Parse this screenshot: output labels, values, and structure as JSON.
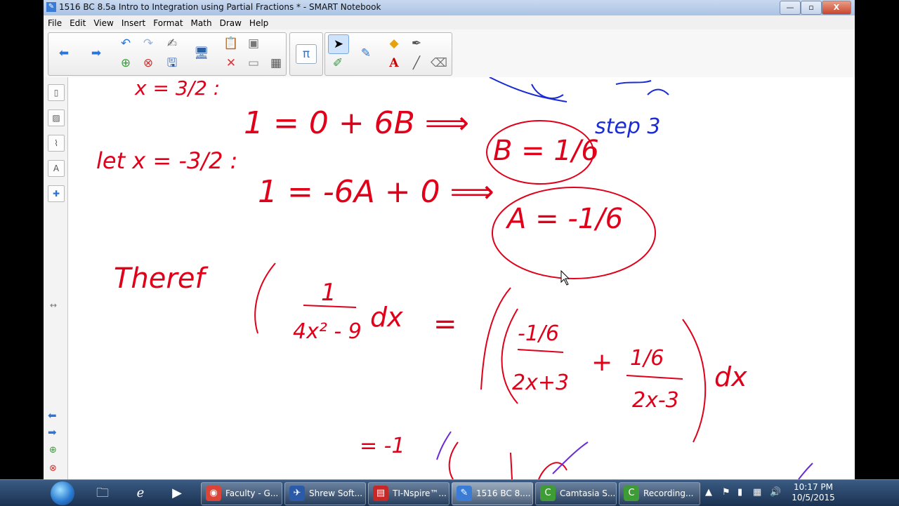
{
  "window": {
    "title": "1516 BC 8.5a Intro to Integration using Partial Fractions * - SMART Notebook",
    "minimize": "—",
    "maximize": "▫",
    "close": "X"
  },
  "menu": [
    "File",
    "Edit",
    "View",
    "Insert",
    "Format",
    "Math",
    "Draw",
    "Help"
  ],
  "toolbar": {
    "back_icon": "arrow-left-icon",
    "forward_icon": "arrow-right-icon",
    "pi_label": "π",
    "text_tool_label": "A"
  },
  "handwriting": {
    "line1_left": "x = 3/2 :",
    "line1_eq": "1 = 0 + 6B ⟹",
    "line1_result": "B = 1/6",
    "line2_left": "let x = -3/2 :",
    "line2_eq": "1 = -6A + 0 ⟹",
    "line2_result": "A = -1/6",
    "therefore": "Theref",
    "integrand_num": "1",
    "integrand_den": "4x² - 9",
    "dx": "dx",
    "equals": "=",
    "frac1_num": "-1/6",
    "frac1_den": "2x+3",
    "plus": "+",
    "frac2_num": "1/6",
    "frac2_den": "2x-3",
    "dx2": "dx",
    "blue_note": "step 3",
    "bottom_partial": "= -1"
  },
  "taskbar": {
    "apps": [
      {
        "label": "Faculty - G...",
        "icon": "chrome-icon",
        "color": "#db4437"
      },
      {
        "label": "Shrew Soft...",
        "icon": "vpn-icon",
        "color": "#2b5aa8"
      },
      {
        "label": "TI-Nspire™...",
        "icon": "calculator-icon",
        "color": "#c62828"
      },
      {
        "label": "1516 BC 8....",
        "icon": "notebook-icon",
        "color": "#3a7bd5"
      },
      {
        "label": "Camtasia S...",
        "icon": "camtasia-icon",
        "color": "#3f9b35"
      },
      {
        "label": "Recording...",
        "icon": "recording-icon",
        "color": "#3f9b35"
      }
    ],
    "time": "10:17 PM",
    "date": "10/5/2015"
  }
}
